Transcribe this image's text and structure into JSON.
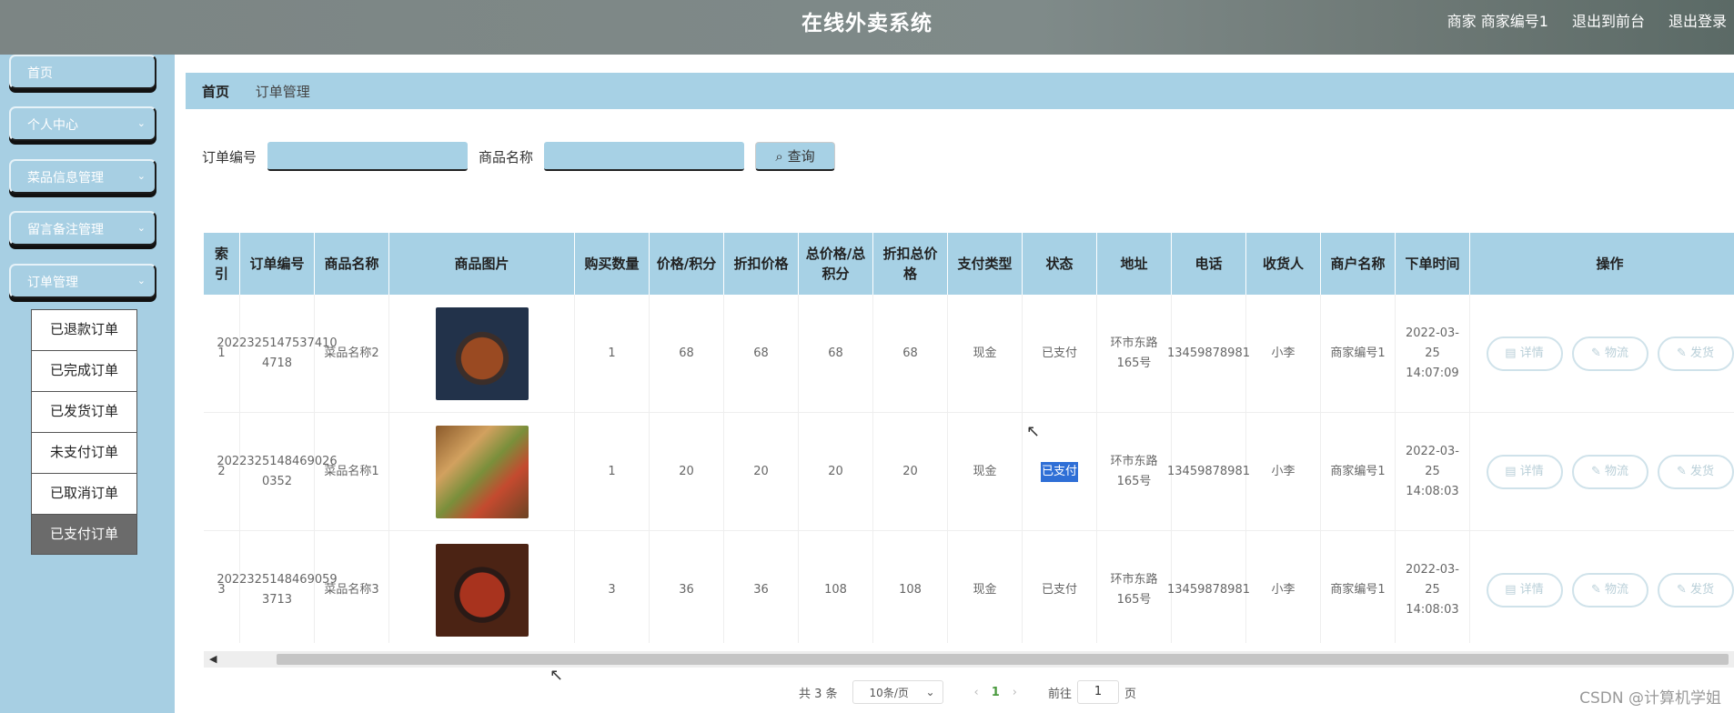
{
  "header": {
    "title": "在线外卖系统",
    "role": "商家",
    "username": "商家编号1",
    "to_front": "退出到前台",
    "logout": "退出登录"
  },
  "sidebar": {
    "items": [
      {
        "label": "首页",
        "has_chevron": false
      },
      {
        "label": "个人中心",
        "has_chevron": true
      },
      {
        "label": "菜品信息管理",
        "has_chevron": true
      },
      {
        "label": "留言备注管理",
        "has_chevron": true
      },
      {
        "label": "订单管理",
        "has_chevron": true
      }
    ],
    "submenu": [
      {
        "label": "已退款订单"
      },
      {
        "label": "已完成订单"
      },
      {
        "label": "已发货订单"
      },
      {
        "label": "未支付订单"
      },
      {
        "label": "已取消订单"
      },
      {
        "label": "已支付订单",
        "active": true
      }
    ]
  },
  "breadcrumb": {
    "home": "首页",
    "current": "订单管理"
  },
  "search": {
    "order_no_label": "订单编号",
    "order_no_value": "",
    "product_label": "商品名称",
    "product_value": "",
    "query_button": "查询"
  },
  "table": {
    "headers": [
      "索引",
      "订单编号",
      "商品名称",
      "商品图片",
      "购买数量",
      "价格/积分",
      "折扣价格",
      "总价格/总积分",
      "折扣总价格",
      "支付类型",
      "状态",
      "地址",
      "电话",
      "收货人",
      "商户名称",
      "下单时间",
      "操作"
    ],
    "rows": [
      {
        "index": "1",
        "order_no": "2022325147537410 4718",
        "product": "菜品名称2",
        "qty": "1",
        "price": "68",
        "discount_price": "68",
        "total": "68",
        "discount_total": "68",
        "pay_type": "现金",
        "status": "已支付",
        "address": "环市东路165号",
        "phone": "13459878981",
        "receiver": "小李",
        "merchant": "商家编号1",
        "time": "2022-03-25 14:07:09"
      },
      {
        "index": "2",
        "order_no": "2022325148469026 0352",
        "product": "菜品名称1",
        "qty": "1",
        "price": "20",
        "discount_price": "20",
        "total": "20",
        "discount_total": "20",
        "pay_type": "现金",
        "status": "已支付",
        "address": "环市东路165号",
        "phone": "13459878981",
        "receiver": "小李",
        "merchant": "商家编号1",
        "time": "2022-03-25 14:08:03"
      },
      {
        "index": "3",
        "order_no": "2022325148469059 3713",
        "product": "菜品名称3",
        "qty": "3",
        "price": "36",
        "discount_price": "36",
        "total": "108",
        "discount_total": "108",
        "pay_type": "现金",
        "status": "已支付",
        "address": "环市东路165号",
        "phone": "13459878981",
        "receiver": "小李",
        "merchant": "商家编号1",
        "time": "2022-03-25 14:08:03"
      }
    ],
    "actions": [
      "详情",
      "物流",
      "发货"
    ]
  },
  "pager": {
    "total": "共 3 条",
    "page_size": "10条/页",
    "current_page": "1",
    "goto_label": "前往",
    "goto_value": "1",
    "page_unit": "页"
  },
  "watermark": "CSDN @计算机学姐"
}
